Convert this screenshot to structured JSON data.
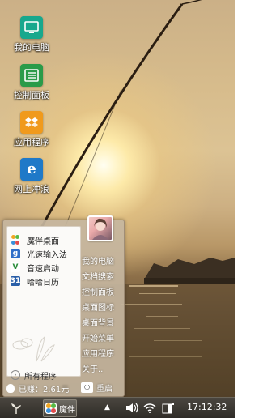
{
  "desktop": {
    "icons": [
      {
        "label": "我的电脑",
        "icon": "monitor-icon",
        "color": "#17a88d"
      },
      {
        "label": "控制面板",
        "icon": "control-panel-icon",
        "color": "#2a9b49"
      },
      {
        "label": "应用程序",
        "icon": "dropbox-icon",
        "color": "#f09a1c"
      },
      {
        "label": "网上冲浪",
        "icon": "ie-icon",
        "color": "#1f79c8"
      }
    ]
  },
  "start_menu": {
    "apps": [
      {
        "label": "魔伴桌面",
        "icon": "mobanzhuomian-icon"
      },
      {
        "label": "光速输入法",
        "icon": "input-method-icon"
      },
      {
        "label": "音速启动",
        "icon": "vstart-icon"
      },
      {
        "label": "哈哈日历",
        "icon": "calendar-icon"
      }
    ],
    "side_links": [
      "我的电脑",
      "文档搜索",
      "控制面板",
      "桌面图标",
      "桌面背景",
      "开始菜单",
      "应用程序",
      "关于.."
    ],
    "all_programs": "所有程序",
    "earnings": "已赚：2.61元",
    "restart": "重启"
  },
  "taskbar": {
    "app_label": "魔伴",
    "clock": "17:12:32"
  }
}
